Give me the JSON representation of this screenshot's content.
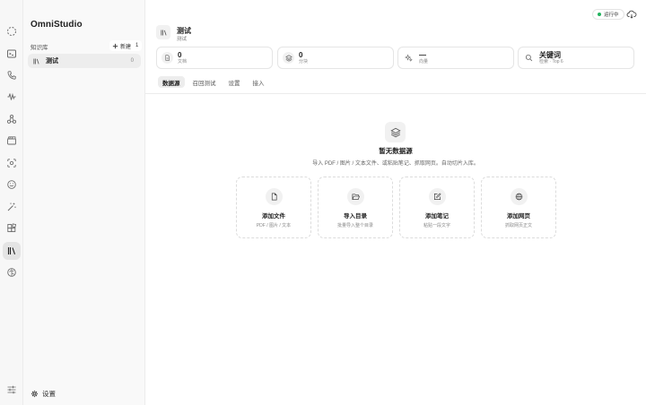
{
  "app": {
    "title": "OmniStudio"
  },
  "rail": {
    "icons": [
      "dashed-circle-icon",
      "terminal-icon",
      "phone-icon",
      "waveform-icon",
      "nodes-icon",
      "clapperboard-icon",
      "scan-face-icon",
      "smiley-icon",
      "magic-wand-icon",
      "blocks-icon",
      "library-icon",
      "brain-icon"
    ],
    "active": "library-icon",
    "bottom_icon": "sliders-icon"
  },
  "sidebar": {
    "section_label": "知识库",
    "new_label": "新建",
    "kb_total": "1",
    "items": [
      {
        "name": "测试",
        "count": "0"
      }
    ],
    "settings_label": "设置"
  },
  "status": {
    "label": "运行中",
    "color": "#22b35e"
  },
  "header": {
    "title": "测试",
    "subtitle": "测试"
  },
  "stats": [
    {
      "value": "0",
      "label": "文档",
      "icon": "document-icon"
    },
    {
      "value": "0",
      "label": "分块",
      "icon": "layers-icon"
    },
    {
      "value": "—",
      "label": "向量",
      "icon": "sparkle-icon"
    },
    {
      "value": "关键词",
      "label": "检索 · Top 6",
      "icon": "search-icon"
    }
  ],
  "tabs": [
    {
      "label": "数据源",
      "active": true
    },
    {
      "label": "召回测试",
      "active": false
    },
    {
      "label": "设置",
      "active": false
    },
    {
      "label": "接入",
      "active": false
    }
  ],
  "empty": {
    "title": "暂无数据源",
    "description": "导入 PDF / 图片 / 文本文件、或粘贴笔记、抓取网页。自动切片入库。"
  },
  "actions": [
    {
      "title": "添加文件",
      "desc": "PDF / 图片 / 文本",
      "icon": "file-icon"
    },
    {
      "title": "导入目录",
      "desc": "批量导入整个目录",
      "icon": "folder-open-icon"
    },
    {
      "title": "添加笔记",
      "desc": "粘贴一段文字",
      "icon": "note-edit-icon"
    },
    {
      "title": "添加网页",
      "desc": "抓取网页正文",
      "icon": "globe-icon"
    }
  ]
}
